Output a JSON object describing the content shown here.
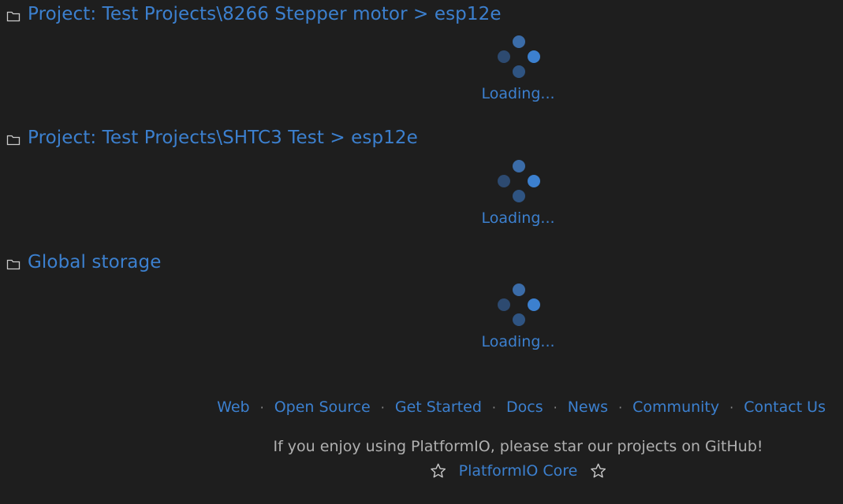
{
  "sections": [
    {
      "title": "Project: Test Projects\\8266 Stepper motor > esp12e",
      "loading_text": "Loading..."
    },
    {
      "title": "Project: Test Projects\\SHTC3 Test > esp12e",
      "loading_text": "Loading..."
    },
    {
      "title": "Global storage",
      "loading_text": "Loading..."
    }
  ],
  "icons": {
    "section": "folder-icon",
    "loader": "spinner-dots-icon",
    "star": "star-outline-icon"
  },
  "footer": {
    "links": [
      "Web",
      "Open Source",
      "Get Started",
      "Docs",
      "News",
      "Community",
      "Contact Us"
    ],
    "separator": "·",
    "enjoy_text": "If you enjoy using PlatformIO, please star our projects on GitHub!",
    "star_link": "PlatformIO Core"
  },
  "colors": {
    "background": "#1e1e1e",
    "accent": "#3c80cf",
    "muted_text": "#b0b0b0"
  }
}
